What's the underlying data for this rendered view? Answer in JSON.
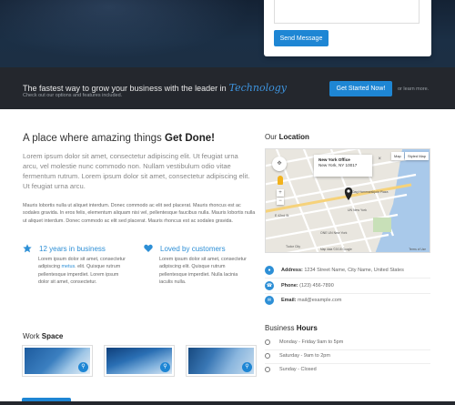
{
  "contact_form": {
    "submit_label": "Send Message"
  },
  "cta": {
    "title": "The fastest way to grow your business with the leader in",
    "brand": "Technology",
    "subtitle": "Check out our options and features included.",
    "button_label": "Get Started Now!",
    "alt_link": "or learn more."
  },
  "intro": {
    "heading_plain": "A place where amazing things",
    "heading_bold": "Get Done!",
    "lead": "Lorem ipsum dolor sit amet, consectetur adipiscing elit. Ut feugiat urna arcu, vel molestie nunc commodo non. Nullam vestibulum odio vitae fermentum rutrum. Lorem ipsum dolor sit amet, consectetur adipiscing elit. Ut feugiat urna arcu.",
    "body": "Mauris lobortis nulla ut aliquet interdum. Donec commodo ac elit sed placerat. Mauris rhoncus est ac sodales gravida. In eros felis, elementum aliquam nisi vel, pellentesque faucibus nulla. Mauris lobortis nulla ut aliquet interdum. Donec commodo ac elit sed placerat. Mauris rhoncus est ac sodales gravida."
  },
  "features": [
    {
      "title": "12 years in business",
      "icon": "star-icon",
      "text_before": "Lorem ipsum dolor sit amet, consectetur adipiscing",
      "link": "metus",
      "text_after": ". elit. Quisque rutrum pellentesque imperdiet. Lorem ipsum dolor sit amet, consectetur."
    },
    {
      "title": "Loved by customers",
      "icon": "heart-icon",
      "text_before": "Lorem ipsum dolor sit amet, consectetur adipiscing elit. Quisque rutrum pellentesque imperdiet. Nulla lacinia iaculis nulla.",
      "link": "",
      "text_after": ""
    }
  ],
  "work": {
    "title_plain": "Work",
    "title_bold": "Space"
  },
  "location": {
    "title_plain": "Our",
    "title_bold": "Location",
    "map": {
      "popup_title": "New York Office",
      "popup_address": "New York, NY 10017",
      "type_map": "Map",
      "type_styled": "Styled Map",
      "footer": "Map data ©2015 Google",
      "terms": "Terms of Use",
      "labels": [
        "E 42nd St",
        "Dag Hammarskjold Plaza",
        "UN New York",
        "Tudor City",
        "ONE UN New York"
      ]
    }
  },
  "contact": {
    "address_label": "Address:",
    "address_value": "1234 Street Name, City Name, United States",
    "phone_label": "Phone:",
    "phone_value": "(123) 456-7890",
    "email_label": "Email:",
    "email_value": "mail@example.com"
  },
  "hours": {
    "title_plain": "Business",
    "title_bold": "Hours",
    "rows": [
      "Monday - Friday 9am to 5pm",
      "Saturday - 9am to 2pm",
      "Sunday - Closed"
    ]
  },
  "colors": {
    "accent": "#1e86d4",
    "dark_band": "#24272d",
    "hero": "#1b2f45"
  }
}
